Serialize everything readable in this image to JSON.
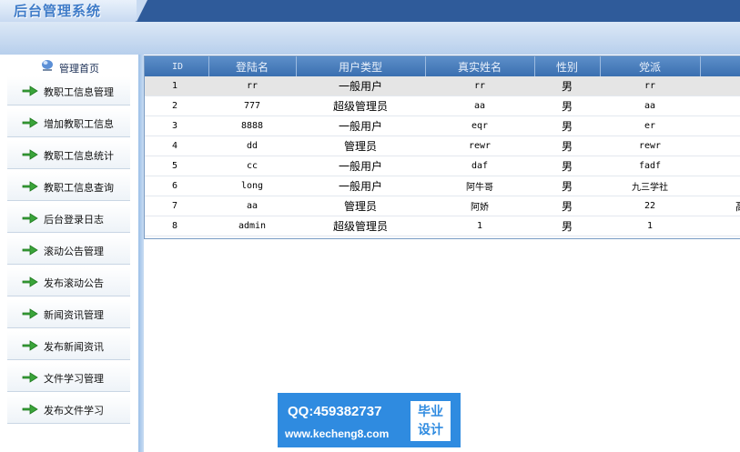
{
  "app": {
    "title": "后台管理系统"
  },
  "sidebar": {
    "home": {
      "label": "管理首页",
      "icon": "globe-icon"
    },
    "items": [
      {
        "label": "教职工信息管理",
        "icon": "arrow-icon"
      },
      {
        "label": "增加教职工信息",
        "icon": "arrow-icon"
      },
      {
        "label": "教职工信息统计",
        "icon": "arrow-icon"
      },
      {
        "label": "教职工信息查询",
        "icon": "arrow-icon"
      },
      {
        "label": "后台登录日志",
        "icon": "arrow-icon"
      },
      {
        "label": "滚动公告管理",
        "icon": "arrow-icon"
      },
      {
        "label": "发布滚动公告",
        "icon": "arrow-icon"
      },
      {
        "label": "新闻资讯管理",
        "icon": "arrow-icon"
      },
      {
        "label": "发布新闻资讯",
        "icon": "arrow-icon"
      },
      {
        "label": "文件学习管理",
        "icon": "arrow-icon"
      },
      {
        "label": "发布文件学习",
        "icon": "arrow-icon"
      }
    ]
  },
  "table": {
    "headers": [
      "ID",
      "登陆名",
      "用户类型",
      "真实姓名",
      "性别",
      "党派",
      ""
    ],
    "rows": [
      [
        "1",
        "rr",
        "一般用户",
        "rr",
        "男",
        "rr",
        ""
      ],
      [
        "2",
        "777",
        "超级管理员",
        "aa",
        "男",
        "aa",
        ""
      ],
      [
        "3",
        "8888",
        "一般用户",
        "eqr",
        "男",
        "er",
        ""
      ],
      [
        "4",
        "dd",
        "管理员",
        "rewr",
        "男",
        "rewr",
        ""
      ],
      [
        "5",
        "cc",
        "一般用户",
        "daf",
        "男",
        "fadf",
        ""
      ],
      [
        "6",
        "long",
        "一般用户",
        "阿牛哥",
        "男",
        "九三学社",
        ""
      ],
      [
        "7",
        "aa",
        "管理员",
        "阿娇",
        "男",
        "22",
        "高"
      ],
      [
        "8",
        "admin",
        "超级管理员",
        "1",
        "男",
        "1",
        ""
      ]
    ]
  },
  "watermark": {
    "qq": "QQ:459382737",
    "url": "www.kecheng8.com",
    "badge_line1": "毕业",
    "badge_line2": "设计"
  },
  "colors": {
    "header_blue": "#2f5b9a",
    "table_header": "#3a6fb0",
    "watermark_blue": "#2f8be0",
    "arrow_green": "#3aa43a"
  }
}
